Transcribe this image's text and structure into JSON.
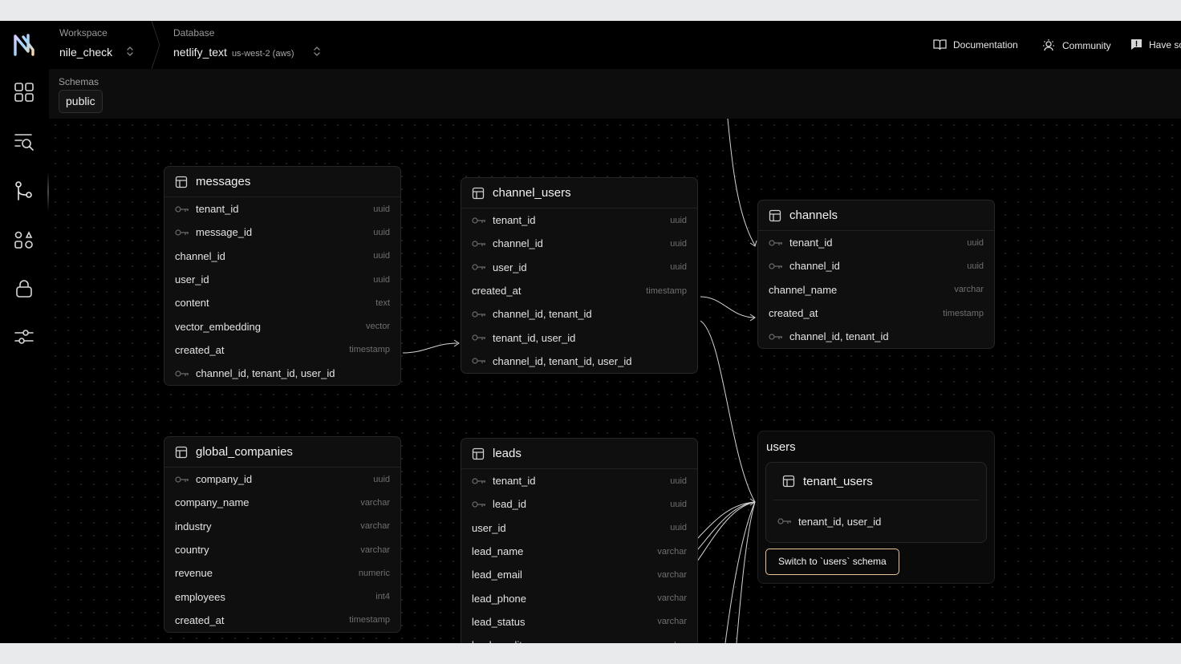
{
  "colors": {
    "accent_border": "#e9c49a",
    "background": "#000000",
    "panel": "#0f0f0f"
  },
  "header": {
    "workspace": {
      "label": "Workspace",
      "value": "nile_check"
    },
    "database": {
      "label": "Database",
      "value": "netlify_text",
      "region": "us-west-2 (aws)"
    },
    "links": [
      {
        "label": "Documentation",
        "icon": "book-icon"
      },
      {
        "label": "Community",
        "icon": "community-icon"
      },
      {
        "label": "Have so",
        "icon": "feedback-icon"
      }
    ]
  },
  "sidebar": {
    "items": [
      {
        "icon": "dashboard-icon"
      },
      {
        "icon": "query-icon"
      },
      {
        "icon": "schema-icon"
      },
      {
        "icon": "tenants-icon"
      },
      {
        "icon": "lock-icon"
      },
      {
        "icon": "settings-sliders-icon"
      }
    ]
  },
  "schemas": {
    "label": "Schemas",
    "selected": "public"
  },
  "tables": {
    "messages": {
      "name": "messages",
      "columns": [
        {
          "name": "tenant_id",
          "type": "uuid",
          "key": true
        },
        {
          "name": "message_id",
          "type": "uuid",
          "key": true
        },
        {
          "name": "channel_id",
          "type": "uuid",
          "key": false
        },
        {
          "name": "user_id",
          "type": "uuid",
          "key": false
        },
        {
          "name": "content",
          "type": "text",
          "key": false
        },
        {
          "name": "vector_embedding",
          "type": "vector",
          "key": false
        },
        {
          "name": "created_at",
          "type": "timestamp",
          "key": false
        },
        {
          "name": "channel_id, tenant_id, user_id",
          "type": "",
          "key": true
        }
      ]
    },
    "channel_users": {
      "name": "channel_users",
      "columns": [
        {
          "name": "tenant_id",
          "type": "uuid",
          "key": true
        },
        {
          "name": "channel_id",
          "type": "uuid",
          "key": true
        },
        {
          "name": "user_id",
          "type": "uuid",
          "key": true
        },
        {
          "name": "created_at",
          "type": "timestamp",
          "key": false
        },
        {
          "name": "channel_id, tenant_id",
          "type": "",
          "key": true
        },
        {
          "name": "tenant_id, user_id",
          "type": "",
          "key": true
        },
        {
          "name": "channel_id, tenant_id, user_id",
          "type": "",
          "key": true
        }
      ]
    },
    "channels": {
      "name": "channels",
      "columns": [
        {
          "name": "tenant_id",
          "type": "uuid",
          "key": true
        },
        {
          "name": "channel_id",
          "type": "uuid",
          "key": true
        },
        {
          "name": "channel_name",
          "type": "varchar",
          "key": false
        },
        {
          "name": "created_at",
          "type": "timestamp",
          "key": false
        },
        {
          "name": "channel_id, tenant_id",
          "type": "",
          "key": true
        }
      ]
    },
    "global_companies": {
      "name": "global_companies",
      "columns": [
        {
          "name": "company_id",
          "type": "uuid",
          "key": true
        },
        {
          "name": "company_name",
          "type": "varchar",
          "key": false
        },
        {
          "name": "industry",
          "type": "varchar",
          "key": false
        },
        {
          "name": "country",
          "type": "varchar",
          "key": false
        },
        {
          "name": "revenue",
          "type": "numeric",
          "key": false
        },
        {
          "name": "employees",
          "type": "int4",
          "key": false
        },
        {
          "name": "created_at",
          "type": "timestamp",
          "key": false
        }
      ]
    },
    "leads": {
      "name": "leads",
      "columns": [
        {
          "name": "tenant_id",
          "type": "uuid",
          "key": true
        },
        {
          "name": "lead_id",
          "type": "uuid",
          "key": true
        },
        {
          "name": "user_id",
          "type": "uuid",
          "key": false
        },
        {
          "name": "lead_name",
          "type": "varchar",
          "key": false
        },
        {
          "name": "lead_email",
          "type": "varchar",
          "key": false
        },
        {
          "name": "lead_phone",
          "type": "varchar",
          "key": false
        },
        {
          "name": "lead_status",
          "type": "varchar",
          "key": false
        },
        {
          "name": "lead_quality",
          "type": "varchar",
          "key": false
        }
      ]
    }
  },
  "users_group": {
    "title": "users",
    "table": {
      "name": "tenant_users",
      "columns": [
        {
          "name": "tenant_id, user_id",
          "type": "",
          "key": true
        }
      ]
    },
    "switch_label": "Switch to `users` schema"
  }
}
